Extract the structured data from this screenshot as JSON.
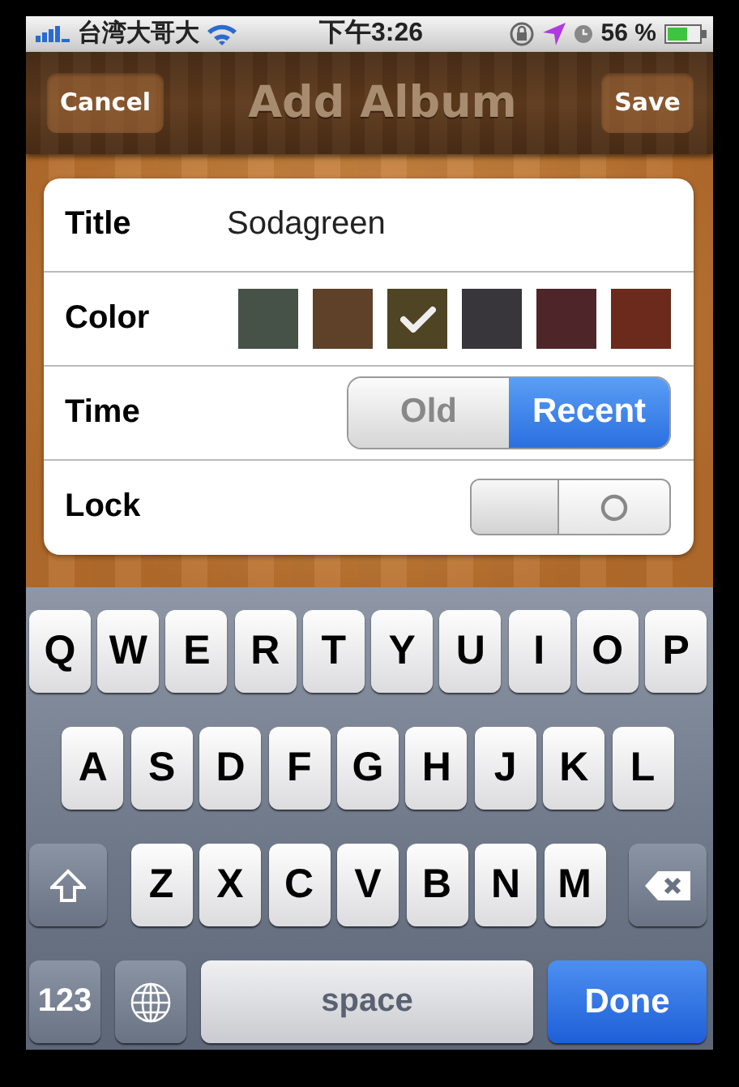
{
  "status_bar": {
    "carrier": "台湾大哥大",
    "time": "下午3:26",
    "battery": "56 %"
  },
  "nav_bar": {
    "cancel": "Cancel",
    "title": "Add Album",
    "save": "Save"
  },
  "form": {
    "title": {
      "label": "Title",
      "value": "Sodagreen"
    },
    "color": {
      "label": "Color",
      "colors": [
        {
          "color": "#465148",
          "selected": false
        },
        {
          "color": "#5e4128",
          "selected": false
        },
        {
          "color": "#4f4423",
          "selected": true
        },
        {
          "color": "#38363a",
          "selected": false
        },
        {
          "color": "#4e2529",
          "selected": false
        },
        {
          "color": "#6b2a1c",
          "selected": false
        }
      ]
    },
    "time": {
      "label": "Time",
      "segments": [
        {
          "label": "Old",
          "selected": false
        },
        {
          "label": "Recent",
          "selected": true
        }
      ]
    },
    "lock": {
      "label": "Lock",
      "on": false
    }
  },
  "keyboard": {
    "rows": [
      {
        "keys": [
          {
            "kind": "letter",
            "label": "Q"
          },
          {
            "kind": "letter",
            "label": "W"
          },
          {
            "kind": "letter",
            "label": "E"
          },
          {
            "kind": "letter",
            "label": "R"
          },
          {
            "kind": "letter",
            "label": "T"
          },
          {
            "kind": "letter",
            "label": "Y"
          },
          {
            "kind": "letter",
            "label": "U"
          },
          {
            "kind": "letter",
            "label": "I"
          },
          {
            "kind": "letter",
            "label": "O"
          },
          {
            "kind": "letter",
            "label": "P"
          }
        ]
      },
      {
        "keys": [
          {
            "kind": "letter",
            "label": "A"
          },
          {
            "kind": "letter",
            "label": "S"
          },
          {
            "kind": "letter",
            "label": "D"
          },
          {
            "kind": "letter",
            "label": "F"
          },
          {
            "kind": "letter",
            "label": "G"
          },
          {
            "kind": "letter",
            "label": "H"
          },
          {
            "kind": "letter",
            "label": "J"
          },
          {
            "kind": "letter",
            "label": "K"
          },
          {
            "kind": "letter",
            "label": "L"
          }
        ]
      },
      {
        "keys": [
          {
            "kind": "shift"
          },
          {
            "kind": "letter",
            "label": "Z"
          },
          {
            "kind": "letter",
            "label": "X"
          },
          {
            "kind": "letter",
            "label": "C"
          },
          {
            "kind": "letter",
            "label": "V"
          },
          {
            "kind": "letter",
            "label": "B"
          },
          {
            "kind": "letter",
            "label": "N"
          },
          {
            "kind": "letter",
            "label": "M"
          },
          {
            "kind": "delete"
          }
        ]
      },
      {
        "keys": [
          {
            "kind": "numbers",
            "label": "123"
          },
          {
            "kind": "globe"
          },
          {
            "kind": "space",
            "label": "space"
          },
          {
            "kind": "done",
            "label": "Done"
          }
        ]
      }
    ]
  }
}
